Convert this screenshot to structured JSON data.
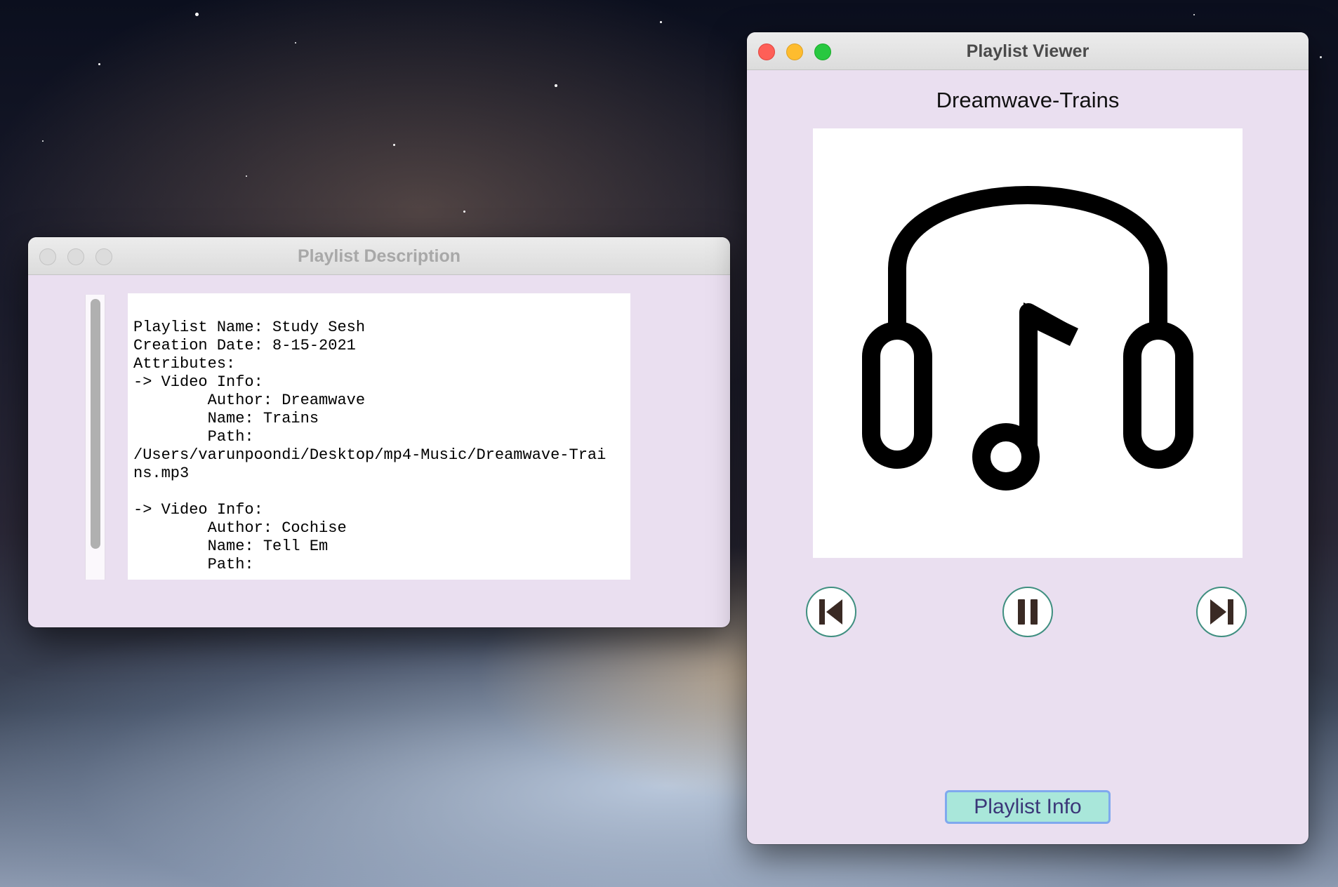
{
  "desktop": {
    "wallpaper": "earth-from-space-galaxy"
  },
  "description_window": {
    "title": "Playlist Description",
    "lines": [
      "Playlist Name: Study Sesh",
      "Creation Date: 8-15-2021",
      "Attributes:",
      "-> Video Info:",
      "        Author: Dreamwave",
      "        Name: Trains",
      "        Path:",
      "/Users/varunpoondi/Desktop/mp4-Music/Dreamwave-Trai",
      "ns.mp3",
      "",
      "-> Video Info:",
      "        Author: Cochise",
      "        Name: Tell Em",
      "        Path:"
    ]
  },
  "viewer_window": {
    "title": "Playlist Viewer",
    "song_title": "Dreamwave-Trains",
    "album_art_icon": "headphones-music-note-icon",
    "controls": {
      "previous_icon": "skip-back-icon",
      "pause_icon": "pause-icon",
      "next_icon": "skip-forward-icon"
    },
    "playlist_info_label": "Playlist Info"
  },
  "colors": {
    "window_background": "#eadff0",
    "button_fill": "#a9e7da",
    "button_border": "#7fa9ee",
    "button_text": "#3b3778",
    "control_ring": "#3f8f80",
    "traffic_red": "#fe5f57",
    "traffic_yellow": "#febc2e",
    "traffic_green": "#28c840"
  }
}
